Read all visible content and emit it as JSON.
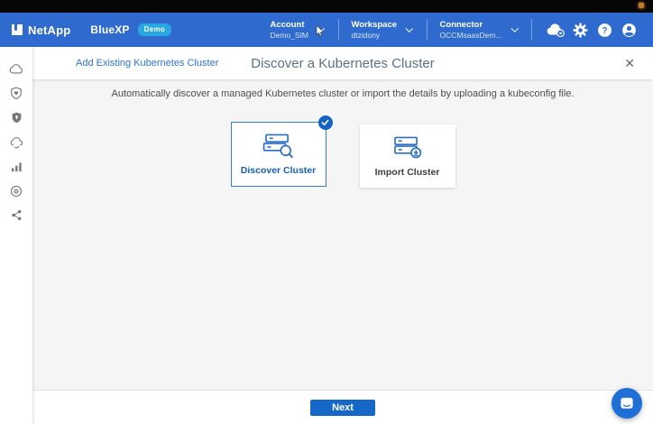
{
  "header": {
    "brand": {
      "company": "NetApp",
      "product": "BlueXP",
      "badge": "Demo"
    },
    "menus": [
      {
        "label": "Account",
        "value": "Demo_SIM"
      },
      {
        "label": "Workspace",
        "value": "dtzidony"
      },
      {
        "label": "Connector",
        "value": "OCCMsaasDem..."
      }
    ],
    "action_icons": [
      "notifications-cloud-icon",
      "settings-gear-icon",
      "help-icon",
      "user-account-icon"
    ]
  },
  "sidebar": {
    "icons": [
      "storage-icon",
      "health-shield-icon",
      "protection-shield-icon",
      "mobility-cloud-icon",
      "analysis-bars-icon",
      "control-icon",
      "extensions-share-icon"
    ]
  },
  "wizard": {
    "breadcrumb": "Add Existing Kubernetes Cluster",
    "title": "Discover a Kubernetes Cluster",
    "close_icon": "✕",
    "description": "Automatically discover a managed Kubernetes cluster or import the details by uploading a kubeconfig file.",
    "options": [
      {
        "label": "Discover Cluster",
        "selected": true,
        "icon": "cluster-search-icon"
      },
      {
        "label": "Import Cluster",
        "selected": false,
        "icon": "cluster-import-icon"
      }
    ],
    "next_button": "Next"
  },
  "colors": {
    "header_blue": "#2F6BCE",
    "demo_badge": "#29A7E1",
    "primary_button": "#1568C8",
    "selected_border": "#3F7CC8",
    "title_text": "#5B7083",
    "link_blue": "#2B74D7"
  }
}
